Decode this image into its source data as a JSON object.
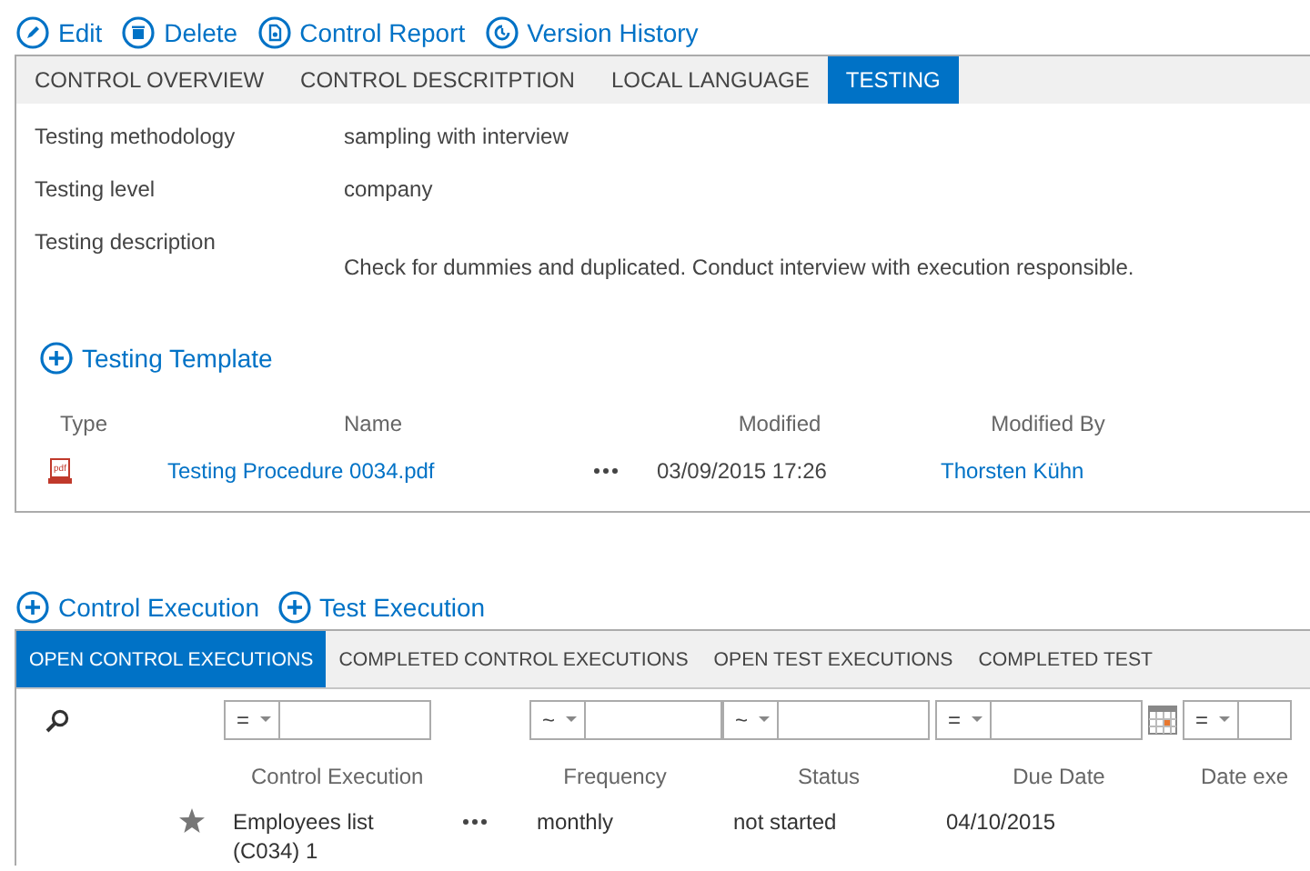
{
  "toolbar": [
    {
      "kind": "edit",
      "label": "Edit"
    },
    {
      "kind": "delete",
      "label": "Delete"
    },
    {
      "kind": "report",
      "label": "Control Report"
    },
    {
      "kind": "history",
      "label": "Version History"
    }
  ],
  "control_tabs": [
    {
      "label": "CONTROL OVERVIEW",
      "selected": false
    },
    {
      "label": "CONTROL DESCRITPTION",
      "selected": false
    },
    {
      "label": "LOCAL LANGUAGE",
      "selected": false
    },
    {
      "label": "TESTING",
      "selected": true
    }
  ],
  "testing_fields": [
    {
      "label": "Testing methodology",
      "value": "sampling with interview",
      "kind": "inline"
    },
    {
      "label": "Testing level",
      "value": "company",
      "kind": "inline"
    },
    {
      "label": "Testing description",
      "value": "Check for dummies and duplicated. Conduct interview with execution responsible.",
      "kind": "below"
    }
  ],
  "template": {
    "add_label": "Testing Template",
    "columns": [
      "Type",
      "Name",
      "Modified",
      "Modified By"
    ],
    "rows": [
      {
        "type": "pdf",
        "name": "Testing Procedure 0034.pdf",
        "modified": "03/09/2015 17:26",
        "modified_by": "Thorsten Kühn"
      }
    ]
  },
  "execution_actions": [
    "Control Execution",
    "Test Execution"
  ],
  "execution_tabs": [
    {
      "label": "OPEN CONTROL EXECUTIONS",
      "selected": true
    },
    {
      "label": "COMPLETED CONTROL EXECUTIONS",
      "selected": false
    },
    {
      "label": "OPEN TEST EXECUTIONS",
      "selected": false
    },
    {
      "label": "COMPLETED TEST",
      "selected": false
    }
  ],
  "execution_table": {
    "filters": [
      {
        "operator": "=",
        "kind": "text"
      },
      {
        "operator": "~",
        "kind": "text"
      },
      {
        "operator": "~",
        "kind": "text"
      },
      {
        "operator": "=",
        "kind": "date"
      },
      {
        "operator": "=",
        "kind": "text"
      }
    ],
    "columns": [
      "Control Execution",
      "Frequency",
      "Status",
      "Due Date",
      "Date exe"
    ],
    "rows": [
      {
        "name": "Employees list (C034) 1",
        "frequency": "monthly",
        "status": "not started",
        "due_date": "04/10/2015"
      }
    ]
  }
}
